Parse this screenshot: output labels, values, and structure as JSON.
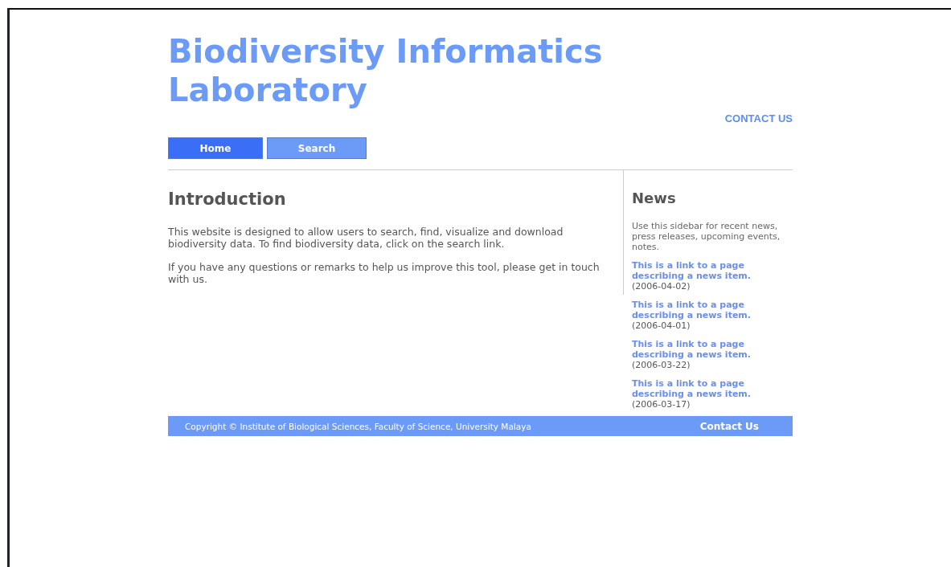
{
  "site_title": "Biodiversity Informatics Laboratory",
  "contact_link": "CONTACT US",
  "nav": [
    {
      "label": "Home",
      "selected": true
    },
    {
      "label": "Search",
      "selected": false
    }
  ],
  "main": {
    "heading": "Introduction",
    "paragraphs": [
      "This website is designed to allow users to search, find, visualize and download biodiversity data. To find biodiversity data, click on the search link.",
      "If you have any questions or remarks to help us improve this tool, please get in touch with us."
    ]
  },
  "sidebar": {
    "heading": "News",
    "intro": "Use this sidebar for recent news, press releases, upcoming events, notes.",
    "items": [
      {
        "link": "This is a link to a page describing a news item.",
        "date": "(2006-04-02)"
      },
      {
        "link": "This is a link to a page describing a news item.",
        "date": "(2006-04-01)"
      },
      {
        "link": "This is a link to a page describing a news item.",
        "date": "(2006-03-22)"
      },
      {
        "link": "This is a link to a page describing a news item.",
        "date": "(2006-03-17)"
      }
    ]
  },
  "footer": {
    "copyright": "Copyright © Institute of Biological Sciences, Faculty of Science, University Malaya",
    "contact": "Contact Us"
  }
}
